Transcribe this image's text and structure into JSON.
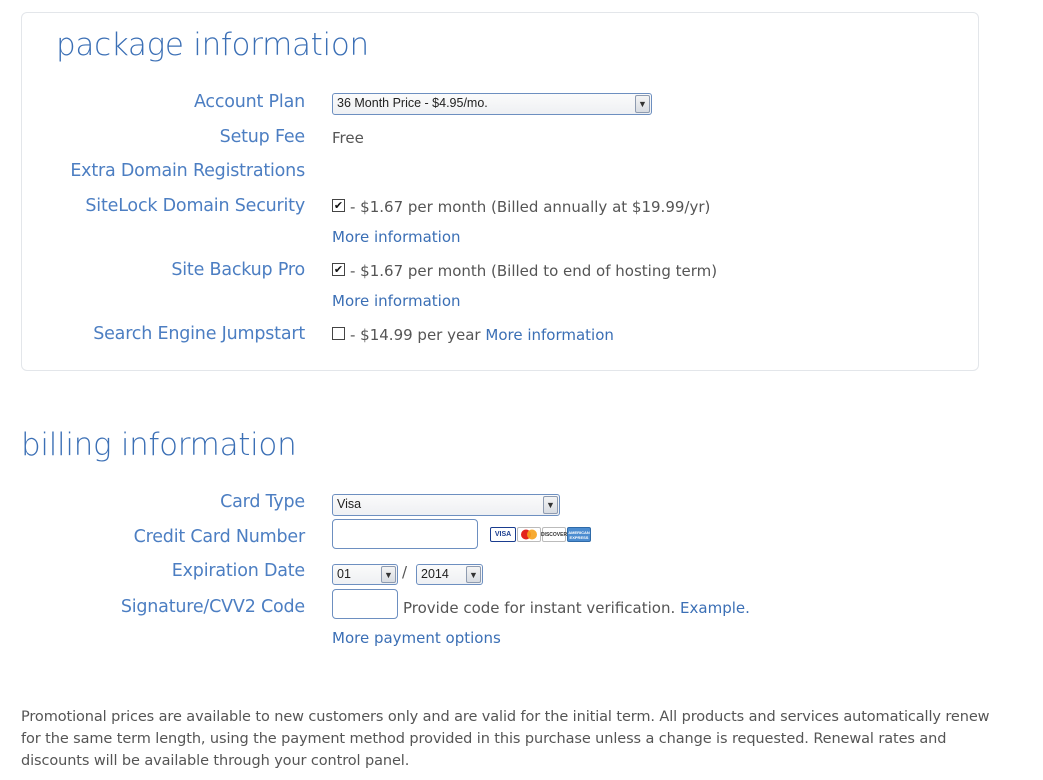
{
  "package": {
    "title": "package information",
    "account_plan_label": "Account Plan",
    "account_plan_value": "36 Month Price - $4.95/mo.",
    "setup_fee_label": "Setup Fee",
    "setup_fee_value": "Free",
    "extra_domain_label": "Extra Domain Registrations",
    "sitelock_label": "SiteLock Domain Security",
    "sitelock_checked": true,
    "sitelock_text": "- $1.67 per month (Billed annually at $19.99/yr)",
    "sitelock_more": "More information",
    "backup_label": "Site Backup Pro",
    "backup_checked": true,
    "backup_text": "- $1.67 per month (Billed to end of hosting term)",
    "backup_more": "More information",
    "seo_label": "Search Engine Jumpstart",
    "seo_checked": false,
    "seo_text": "- $14.99 per year",
    "seo_more": "More information"
  },
  "billing": {
    "title": "billing information",
    "card_type_label": "Card Type",
    "card_type_value": "Visa",
    "card_number_label": "Credit Card Number",
    "card_number_value": "",
    "card_logos": [
      "VISA",
      "MasterCard",
      "DISCOVER",
      "AMERICAN EXPRESS"
    ],
    "expiration_label": "Expiration Date",
    "exp_month": "01",
    "exp_separator": "/",
    "exp_year": "2014",
    "cvv_label": "Signature/CVV2 Code",
    "cvv_value": "",
    "cvv_hint": "Provide code for instant verification.",
    "cvv_example": "Example.",
    "more_payment": "More payment options"
  },
  "footer": {
    "text": "Promotional prices are available to new customers only and are valid for the initial term. All products and services automatically renew for the same term length, using the payment method provided in this purchase unless a change is requested. Renewal rates and discounts will be available through your control panel."
  }
}
